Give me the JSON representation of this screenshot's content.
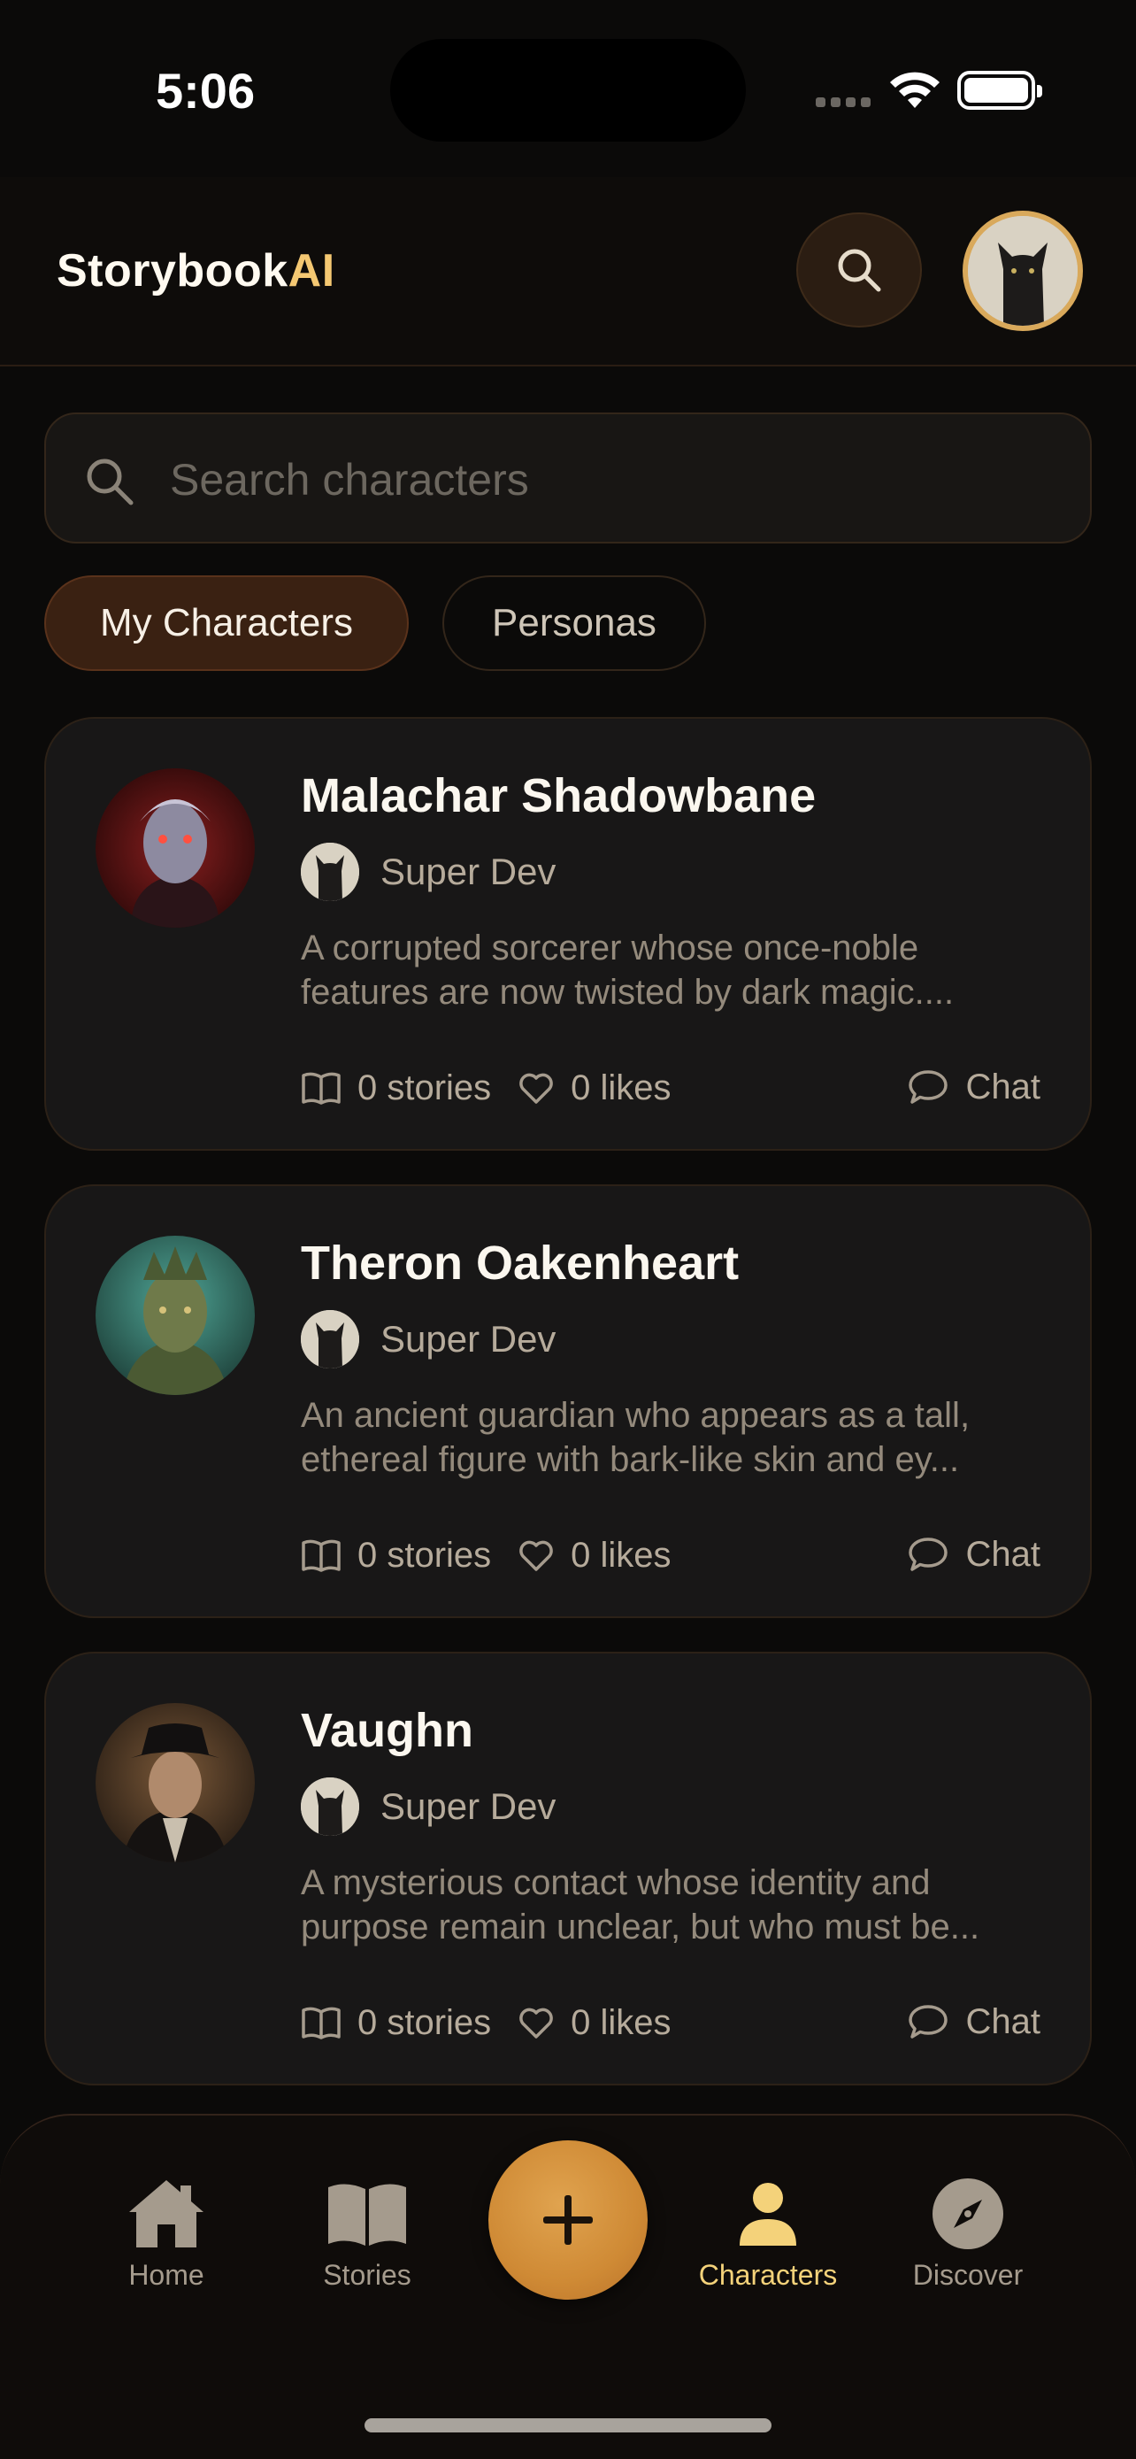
{
  "status_bar": {
    "time": "5:06"
  },
  "header": {
    "logo_main": "Storybook",
    "logo_accent": "AI",
    "accent_color": "#f4c872"
  },
  "search": {
    "placeholder": "Search characters",
    "value": ""
  },
  "tabs": [
    {
      "label": "My Characters",
      "active": true
    },
    {
      "label": "Personas",
      "active": false
    }
  ],
  "characters": [
    {
      "name": "Malachar Shadowbane",
      "creator": "Super Dev",
      "description_line1": "A corrupted sorcerer whose once-noble",
      "description_line2": "features are now twisted by dark magic....",
      "stories": "0 stories",
      "likes": "0 likes",
      "chat_label": "Chat"
    },
    {
      "name": "Theron Oakenheart",
      "creator": "Super Dev",
      "description_line1": "An ancient guardian who appears as a tall,",
      "description_line2": "ethereal figure with bark-like skin and ey...",
      "stories": "0 stories",
      "likes": "0 likes",
      "chat_label": "Chat"
    },
    {
      "name": "Vaughn",
      "creator": "Super Dev",
      "description_line1": "A mysterious contact whose identity and",
      "description_line2": "purpose remain unclear, but who must be...",
      "stories": "0 stories",
      "likes": "0 likes",
      "chat_label": "Chat"
    }
  ],
  "nav": {
    "items": [
      {
        "label": "Home",
        "icon": "home-icon",
        "active": false
      },
      {
        "label": "Stories",
        "icon": "book-icon",
        "active": false
      },
      {
        "label": "Characters",
        "icon": "person-icon",
        "active": true
      },
      {
        "label": "Discover",
        "icon": "compass-icon",
        "active": false
      }
    ],
    "fab_icon": "plus-icon",
    "active_color": "#f4d27a",
    "fab_color": "#d08f3b"
  }
}
